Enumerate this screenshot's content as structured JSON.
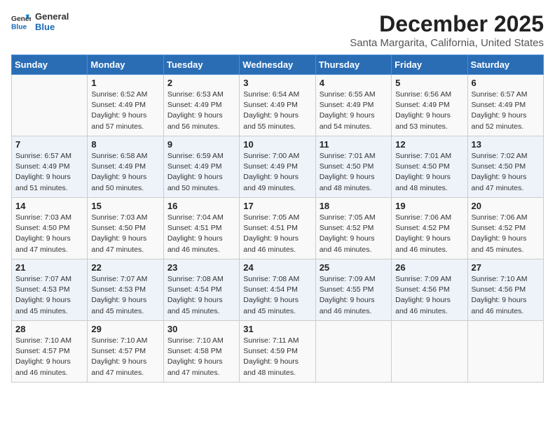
{
  "logo": {
    "line1": "General",
    "line2": "Blue"
  },
  "title": "December 2025",
  "location": "Santa Margarita, California, United States",
  "days_header": [
    "Sunday",
    "Monday",
    "Tuesday",
    "Wednesday",
    "Thursday",
    "Friday",
    "Saturday"
  ],
  "weeks": [
    [
      {
        "num": "",
        "info": ""
      },
      {
        "num": "1",
        "info": "Sunrise: 6:52 AM\nSunset: 4:49 PM\nDaylight: 9 hours\nand 57 minutes."
      },
      {
        "num": "2",
        "info": "Sunrise: 6:53 AM\nSunset: 4:49 PM\nDaylight: 9 hours\nand 56 minutes."
      },
      {
        "num": "3",
        "info": "Sunrise: 6:54 AM\nSunset: 4:49 PM\nDaylight: 9 hours\nand 55 minutes."
      },
      {
        "num": "4",
        "info": "Sunrise: 6:55 AM\nSunset: 4:49 PM\nDaylight: 9 hours\nand 54 minutes."
      },
      {
        "num": "5",
        "info": "Sunrise: 6:56 AM\nSunset: 4:49 PM\nDaylight: 9 hours\nand 53 minutes."
      },
      {
        "num": "6",
        "info": "Sunrise: 6:57 AM\nSunset: 4:49 PM\nDaylight: 9 hours\nand 52 minutes."
      }
    ],
    [
      {
        "num": "7",
        "info": "Sunrise: 6:57 AM\nSunset: 4:49 PM\nDaylight: 9 hours\nand 51 minutes."
      },
      {
        "num": "8",
        "info": "Sunrise: 6:58 AM\nSunset: 4:49 PM\nDaylight: 9 hours\nand 50 minutes."
      },
      {
        "num": "9",
        "info": "Sunrise: 6:59 AM\nSunset: 4:49 PM\nDaylight: 9 hours\nand 50 minutes."
      },
      {
        "num": "10",
        "info": "Sunrise: 7:00 AM\nSunset: 4:49 PM\nDaylight: 9 hours\nand 49 minutes."
      },
      {
        "num": "11",
        "info": "Sunrise: 7:01 AM\nSunset: 4:50 PM\nDaylight: 9 hours\nand 48 minutes."
      },
      {
        "num": "12",
        "info": "Sunrise: 7:01 AM\nSunset: 4:50 PM\nDaylight: 9 hours\nand 48 minutes."
      },
      {
        "num": "13",
        "info": "Sunrise: 7:02 AM\nSunset: 4:50 PM\nDaylight: 9 hours\nand 47 minutes."
      }
    ],
    [
      {
        "num": "14",
        "info": "Sunrise: 7:03 AM\nSunset: 4:50 PM\nDaylight: 9 hours\nand 47 minutes."
      },
      {
        "num": "15",
        "info": "Sunrise: 7:03 AM\nSunset: 4:50 PM\nDaylight: 9 hours\nand 47 minutes."
      },
      {
        "num": "16",
        "info": "Sunrise: 7:04 AM\nSunset: 4:51 PM\nDaylight: 9 hours\nand 46 minutes."
      },
      {
        "num": "17",
        "info": "Sunrise: 7:05 AM\nSunset: 4:51 PM\nDaylight: 9 hours\nand 46 minutes."
      },
      {
        "num": "18",
        "info": "Sunrise: 7:05 AM\nSunset: 4:52 PM\nDaylight: 9 hours\nand 46 minutes."
      },
      {
        "num": "19",
        "info": "Sunrise: 7:06 AM\nSunset: 4:52 PM\nDaylight: 9 hours\nand 46 minutes."
      },
      {
        "num": "20",
        "info": "Sunrise: 7:06 AM\nSunset: 4:52 PM\nDaylight: 9 hours\nand 45 minutes."
      }
    ],
    [
      {
        "num": "21",
        "info": "Sunrise: 7:07 AM\nSunset: 4:53 PM\nDaylight: 9 hours\nand 45 minutes."
      },
      {
        "num": "22",
        "info": "Sunrise: 7:07 AM\nSunset: 4:53 PM\nDaylight: 9 hours\nand 45 minutes."
      },
      {
        "num": "23",
        "info": "Sunrise: 7:08 AM\nSunset: 4:54 PM\nDaylight: 9 hours\nand 45 minutes."
      },
      {
        "num": "24",
        "info": "Sunrise: 7:08 AM\nSunset: 4:54 PM\nDaylight: 9 hours\nand 45 minutes."
      },
      {
        "num": "25",
        "info": "Sunrise: 7:09 AM\nSunset: 4:55 PM\nDaylight: 9 hours\nand 46 minutes."
      },
      {
        "num": "26",
        "info": "Sunrise: 7:09 AM\nSunset: 4:56 PM\nDaylight: 9 hours\nand 46 minutes."
      },
      {
        "num": "27",
        "info": "Sunrise: 7:10 AM\nSunset: 4:56 PM\nDaylight: 9 hours\nand 46 minutes."
      }
    ],
    [
      {
        "num": "28",
        "info": "Sunrise: 7:10 AM\nSunset: 4:57 PM\nDaylight: 9 hours\nand 46 minutes."
      },
      {
        "num": "29",
        "info": "Sunrise: 7:10 AM\nSunset: 4:57 PM\nDaylight: 9 hours\nand 47 minutes."
      },
      {
        "num": "30",
        "info": "Sunrise: 7:10 AM\nSunset: 4:58 PM\nDaylight: 9 hours\nand 47 minutes."
      },
      {
        "num": "31",
        "info": "Sunrise: 7:11 AM\nSunset: 4:59 PM\nDaylight: 9 hours\nand 48 minutes."
      },
      {
        "num": "",
        "info": ""
      },
      {
        "num": "",
        "info": ""
      },
      {
        "num": "",
        "info": ""
      }
    ]
  ]
}
